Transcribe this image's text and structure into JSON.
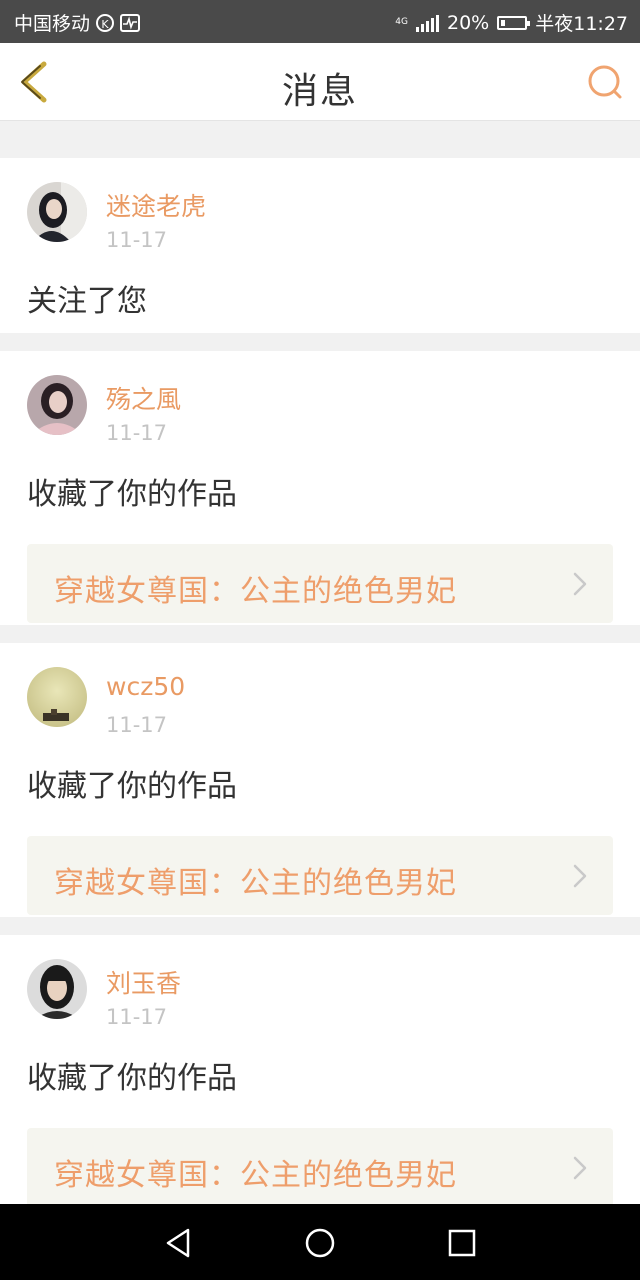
{
  "status_bar": {
    "carrier": "中国移动",
    "k_badge": "K",
    "network": "4G",
    "battery_percent": "20%",
    "battery_level": 0.2,
    "time": "半夜11:27",
    "icons": [
      "k-circle-icon",
      "pulse-icon",
      "signal-icon",
      "battery-icon"
    ]
  },
  "header": {
    "title": "消息",
    "back_icon": "back-chevron-icon",
    "search_icon": "search-icon"
  },
  "messages": [
    {
      "username": "迷途老虎",
      "date": "11-17",
      "action": "关注了您"
    },
    {
      "username": "殇之風",
      "date": "11-17",
      "action": "收藏了你的作品",
      "work_title": "穿越女尊国：公主的绝色男妃"
    },
    {
      "username": "wcz50",
      "date": "11-17",
      "action": "收藏了你的作品",
      "work_title": "穿越女尊国：公主的绝色男妃"
    },
    {
      "username": "刘玉香",
      "date": "11-17",
      "action": "收藏了你的作品",
      "work_title": "穿越女尊国：公主的绝色男妃"
    }
  ],
  "colors": {
    "accent": "#e99a63",
    "status_bar": "#4a4a4a",
    "link_bg": "#f5f5ef",
    "divider": "#f1f1f1"
  },
  "nav_bar": {
    "icons": [
      "back-triangle-icon",
      "home-circle-icon",
      "recents-square-icon"
    ]
  }
}
